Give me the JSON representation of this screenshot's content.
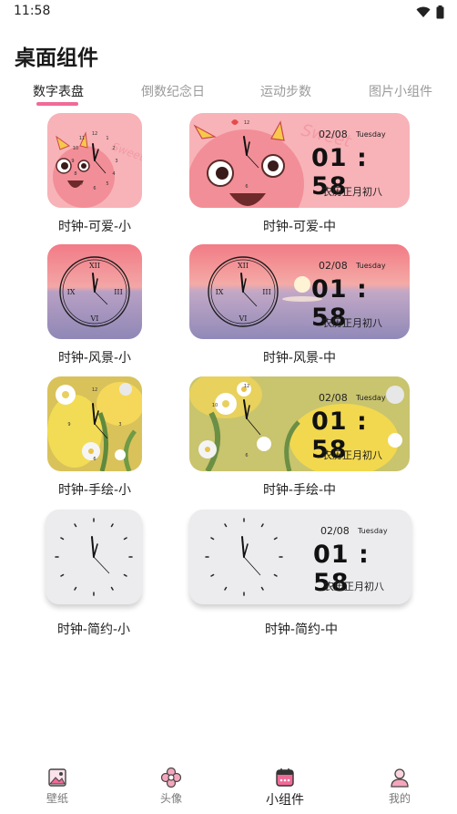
{
  "status_bar": {
    "time": "11:58"
  },
  "page_title": "桌面组件",
  "tabs": [
    {
      "label": "数字表盘",
      "active": true
    },
    {
      "label": "倒数纪念日",
      "active": false
    },
    {
      "label": "运动步数",
      "active": false
    },
    {
      "label": "图片小组件",
      "active": false
    }
  ],
  "widgets": [
    {
      "small_caption": "时钟-可爱-小",
      "medium_caption": "时钟-可爱-中",
      "date": "02/08",
      "day": "Tuesday",
      "time": "01 : 58",
      "lunar": "农历正月初八",
      "style": "cute",
      "deco_text": "Sweet"
    },
    {
      "small_caption": "时钟-风景-小",
      "medium_caption": "时钟-风景-中",
      "date": "02/08",
      "day": "Tuesday",
      "time": "01 : 58",
      "lunar": "农历正月初八",
      "style": "scenery"
    },
    {
      "small_caption": "时钟-手绘-小",
      "medium_caption": "时钟-手绘-中",
      "date": "02/08",
      "day": "Tuesday",
      "time": "01 : 58",
      "lunar": "农历正月初八",
      "style": "handdrawn"
    },
    {
      "small_caption": "时钟-简约-小",
      "medium_caption": "时钟-简约-中",
      "date": "02/08",
      "day": "Tuesday",
      "time": "01 : 58",
      "lunar": "农历正月初八",
      "style": "simple"
    }
  ],
  "roman_numerals": [
    "XII",
    "III",
    "VI",
    "IX"
  ],
  "clock_numerals": [
    "12",
    "3",
    "6",
    "9",
    "1",
    "2",
    "4",
    "5",
    "7",
    "8",
    "10",
    "11"
  ],
  "colors": {
    "accent": "#f06a98",
    "cute_bg": "#f7b3b8",
    "simple_bg": "#ececef",
    "flower_bg": "#c9c46e"
  },
  "bottom_nav": [
    {
      "label": "壁纸",
      "icon": "wallpaper-icon",
      "active": false
    },
    {
      "label": "头像",
      "icon": "avatar-flower-icon",
      "active": false
    },
    {
      "label": "小组件",
      "icon": "widget-icon",
      "active": true
    },
    {
      "label": "我的",
      "icon": "profile-icon",
      "active": false
    }
  ]
}
